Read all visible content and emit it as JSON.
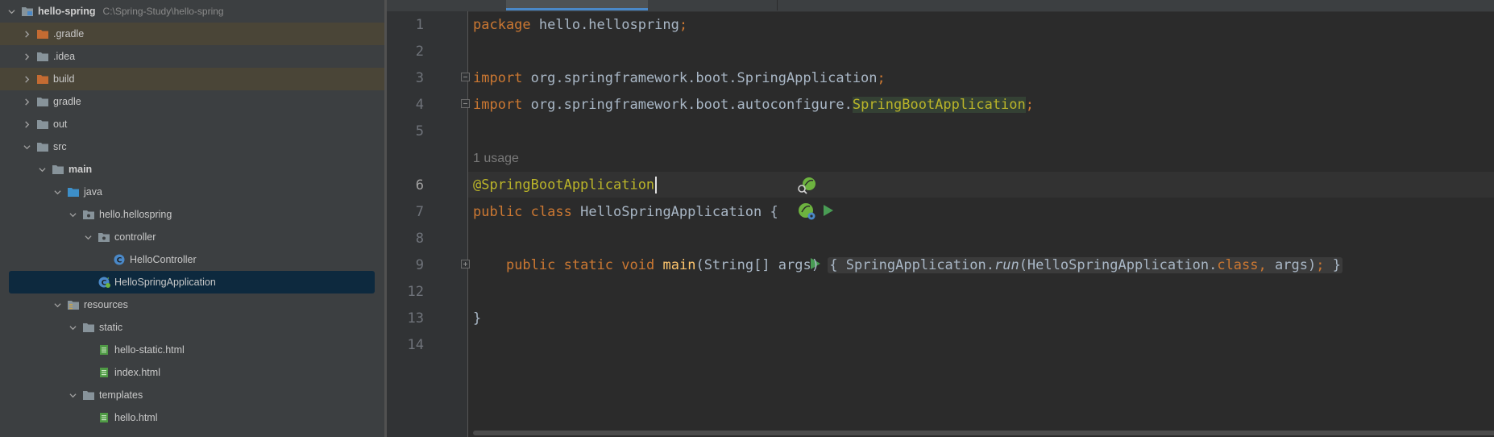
{
  "project_tree": {
    "root": {
      "name": "hello-spring",
      "path": "C:\\Spring-Study\\hello-spring"
    },
    "items": [
      {
        "label": ".gradle",
        "depth": 1,
        "expanded": false,
        "icon": "folder-orange-icon",
        "excluded": true
      },
      {
        "label": ".idea",
        "depth": 1,
        "expanded": false,
        "icon": "folder-icon"
      },
      {
        "label": "build",
        "depth": 1,
        "expanded": false,
        "icon": "folder-orange-icon",
        "excluded": true
      },
      {
        "label": "gradle",
        "depth": 1,
        "expanded": false,
        "icon": "folder-icon"
      },
      {
        "label": "out",
        "depth": 1,
        "expanded": false,
        "icon": "folder-icon"
      },
      {
        "label": "src",
        "depth": 1,
        "expanded": true,
        "icon": "folder-icon"
      },
      {
        "label": "main",
        "depth": 2,
        "expanded": true,
        "icon": "folder-icon",
        "bold": true
      },
      {
        "label": "java",
        "depth": 3,
        "expanded": true,
        "icon": "folder-blue-icon"
      },
      {
        "label": "hello.hellospring",
        "depth": 4,
        "expanded": true,
        "icon": "package-icon"
      },
      {
        "label": "controller",
        "depth": 5,
        "expanded": true,
        "icon": "package-icon"
      },
      {
        "label": "HelloController",
        "depth": 6,
        "icon": "class-icon"
      },
      {
        "label": "HelloSpringApplication",
        "depth": 5,
        "icon": "spring-class-icon",
        "selected": true
      },
      {
        "label": "resources",
        "depth": 3,
        "expanded": true,
        "icon": "resources-folder-icon"
      },
      {
        "label": "static",
        "depth": 4,
        "expanded": true,
        "icon": "folder-icon"
      },
      {
        "label": "hello-static.html",
        "depth": 5,
        "icon": "html-file-icon"
      },
      {
        "label": "index.html",
        "depth": 5,
        "icon": "html-file-icon"
      },
      {
        "label": "templates",
        "depth": 4,
        "expanded": true,
        "icon": "folder-icon"
      },
      {
        "label": "hello.html",
        "depth": 5,
        "icon": "html-file-icon"
      }
    ]
  },
  "editor": {
    "line_numbers": [
      "1",
      "2",
      "3",
      "4",
      "5",
      "6",
      "7",
      "8",
      "9",
      "12",
      "13",
      "14"
    ],
    "usage_hint": "1 usage",
    "code": {
      "l1": [
        "package",
        " hello.hellospring",
        ";"
      ],
      "l3": [
        "import",
        " org.springframework.boot.SpringApplication",
        ";"
      ],
      "l4": [
        "import",
        " org.springframework.boot.autoconfigure.",
        "SpringBootApplication",
        ";"
      ],
      "l6": "@SpringBootApplication",
      "l7": [
        "public",
        " ",
        "class",
        " HelloSpringApplication {"
      ],
      "l9": {
        "indent": "    ",
        "mods": [
          "public",
          "static",
          "void"
        ],
        "method": "main",
        "params": "(String[] args)",
        "body_open": "{",
        "call_class": "SpringApplication.",
        "call_method": "run",
        "call_args_open": "(HelloSpringApplication.",
        "class_kw": "class",
        "comma": ",",
        "args_close": " args)",
        "semi": ";",
        "body_close": "}"
      },
      "l13": "}"
    },
    "colors": {
      "keyword": "#cc7832",
      "annotation": "#bbb529",
      "method": "#ffc66d",
      "text": "#a9b7c6",
      "spring": "#6db33f",
      "run": "#499c54"
    }
  }
}
